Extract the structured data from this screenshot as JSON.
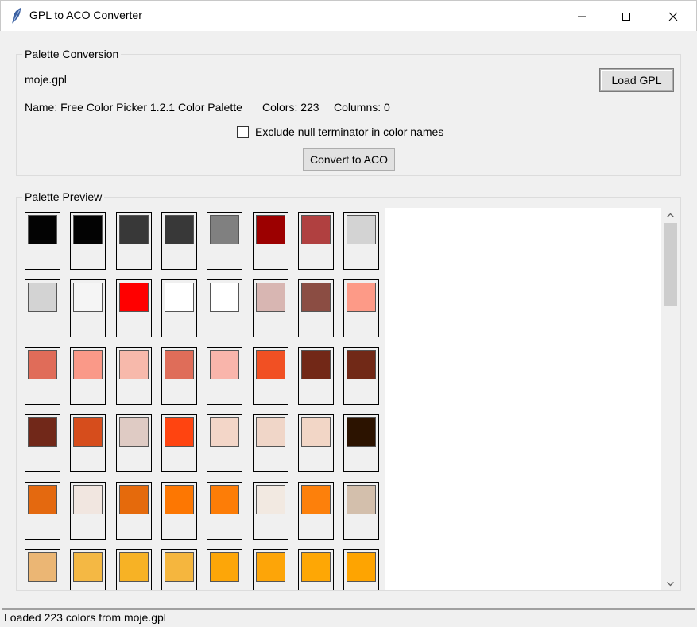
{
  "window": {
    "title": "GPL to ACO Converter"
  },
  "conversion": {
    "group_label": "Palette Conversion",
    "file_name": "moje.gpl",
    "load_label": "Load GPL",
    "name_info": "Name: Free Color Picker 1.2.1 Color Palette",
    "colors_info": "Colors: 223",
    "columns_info": "Columns: 0",
    "exclude_label": "Exclude null terminator in color names",
    "exclude_checked": false,
    "convert_label": "Convert to ACO"
  },
  "preview": {
    "group_label": "Palette Preview",
    "swatches": [
      "#030303",
      "#030303",
      "#383838",
      "#383838",
      "#808080",
      "#9c0000",
      "#b04040",
      "#d3d3d3",
      "#d3d3d3",
      "#f5f5f5",
      "#ff0000",
      "#ffffff",
      "#ffffff",
      "#d8b6b2",
      "#8b4d43",
      "#fd9a87",
      "#e06c59",
      "#fa9988",
      "#f7b9ab",
      "#df6d59",
      "#f9b5ab",
      "#f15023",
      "#722817",
      "#712917",
      "#712819",
      "#d64d1c",
      "#dfcbc4",
      "#ff4410",
      "#f3d6c8",
      "#f0d6c8",
      "#f2d6c6",
      "#2c1300",
      "#e4690f",
      "#f1e6e0",
      "#e56a0c",
      "#fd7702",
      "#fd7d07",
      "#f2e9e1",
      "#fd800b",
      "#d3bfac",
      "#ebb674",
      "#f4b844",
      "#f7b225",
      "#f5b63e",
      "#fda608",
      "#fda508",
      "#fea705",
      "#fea401"
    ]
  },
  "status": {
    "text": "Loaded 223 colors from moje.gpl"
  }
}
